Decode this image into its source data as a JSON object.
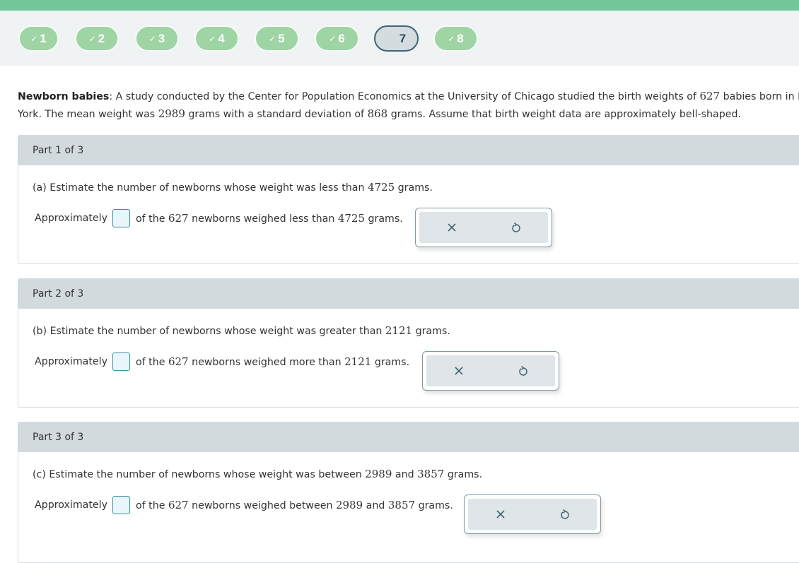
{
  "nav": {
    "steps": [
      {
        "label": "1",
        "status": "complete"
      },
      {
        "label": "2",
        "status": "complete"
      },
      {
        "label": "3",
        "status": "complete"
      },
      {
        "label": "4",
        "status": "complete"
      },
      {
        "label": "5",
        "status": "complete"
      },
      {
        "label": "6",
        "status": "complete"
      },
      {
        "label": "7",
        "status": "current"
      },
      {
        "label": "8",
        "status": "complete"
      }
    ],
    "check_glyph": "✓"
  },
  "intro": {
    "title": "Newborn babies",
    "colon": ":",
    "line1_a": " A study conducted by the Center for Population Economics at the University of Chicago studied the birth weights of ",
    "line1_num": "627",
    "line1_b": " babies born in New",
    "line2_a": "York. The mean weight was ",
    "mean": "2989",
    "line2_b": " grams with a standard deviation of ",
    "sd": "868",
    "line2_c": " grams. Assume that birth weight data are approximately bell-shaped."
  },
  "parts": [
    {
      "header": "Part 1 of 3",
      "q_a": "(a) Estimate the number of newborns whose weight was less than ",
      "q_num1": "4725",
      "q_b": " grams.",
      "q_num2": "",
      "q_c": "",
      "ans_prefix": "Approximately",
      "ans_a": "of the ",
      "ans_total": "627",
      "ans_b": " newborns weighed less than ",
      "ans_num1": "4725",
      "ans_c": " grams.",
      "ans_num2": "",
      "ans_d": "",
      "value": ""
    },
    {
      "header": "Part 2 of 3",
      "q_a": "(b) Estimate the number of newborns whose weight was greater than ",
      "q_num1": "2121",
      "q_b": " grams.",
      "q_num2": "",
      "q_c": "",
      "ans_prefix": "Approximately",
      "ans_a": "of the ",
      "ans_total": "627",
      "ans_b": " newborns weighed more than ",
      "ans_num1": "2121",
      "ans_c": " grams.",
      "ans_num2": "",
      "ans_d": "",
      "value": ""
    },
    {
      "header": "Part 3 of 3",
      "q_a": "(c) Estimate the number of newborns whose weight was between ",
      "q_num1": "2989",
      "q_b": " and ",
      "q_num2": "3857",
      "q_c": " grams.",
      "ans_prefix": "Approximately",
      "ans_a": "of the ",
      "ans_total": "627",
      "ans_b": " newborns weighed between ",
      "ans_num1": "2989",
      "ans_c": " and ",
      "ans_num2": "3857",
      "ans_d": " grams.",
      "value": ""
    }
  ],
  "tools": {
    "clear_icon": "close-icon",
    "undo_icon": "undo-icon"
  },
  "colors": {
    "complete_step": "#9fd4a4",
    "current_step_border": "#3c6577",
    "top_bar": "#72c69a",
    "part_header": "#d3dade"
  }
}
